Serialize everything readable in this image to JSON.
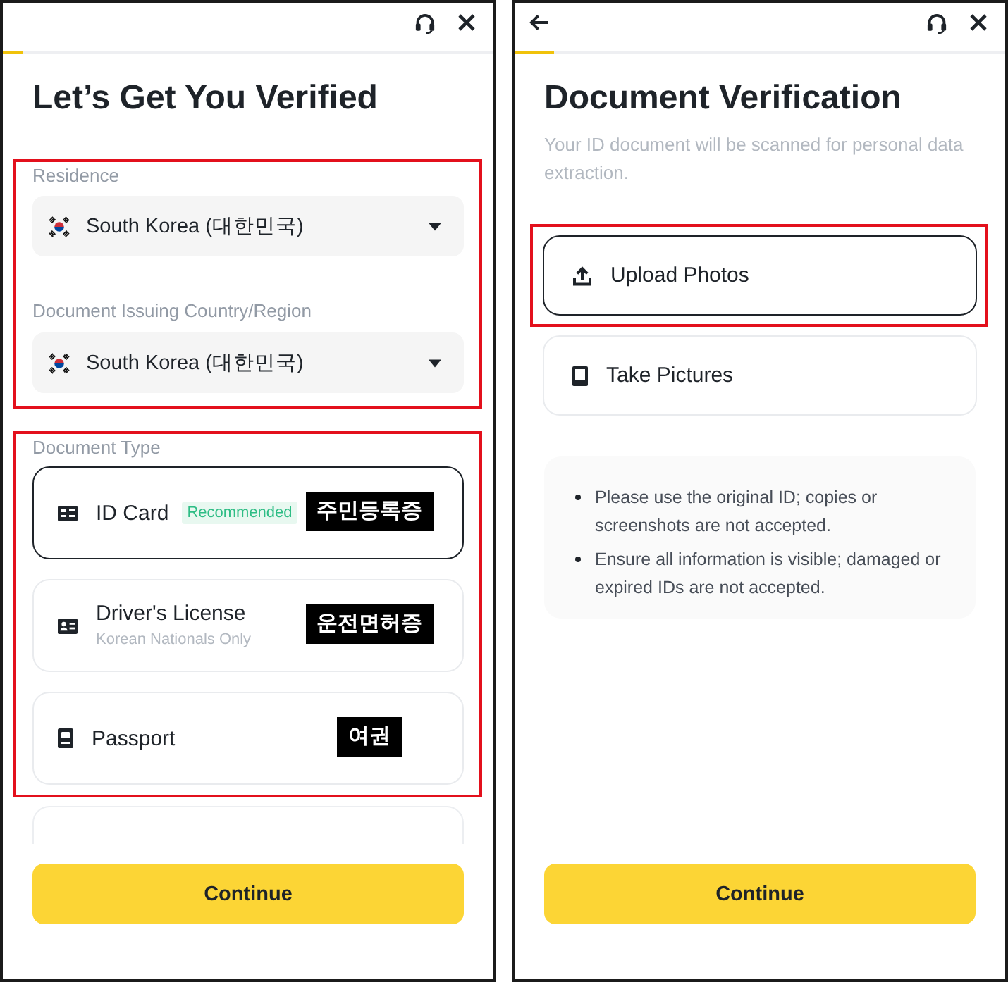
{
  "screens": [
    {
      "kind": "document_type",
      "back_button": false,
      "progress": {
        "level": 0.04
      },
      "title": "Let’s Get You Verified",
      "location_section": {
        "highlighted": true,
        "fields": [
          {
            "label": "Residence",
            "value": "South Korea (대한민국)"
          },
          {
            "label": "Document Issuing Country/Region",
            "value": "South Korea (대한민국)"
          }
        ]
      },
      "document_section": {
        "highlighted": true,
        "label": "Document Type",
        "options": [
          {
            "kind": "id_card",
            "title": "ID Card",
            "badge": "Recommended",
            "annotation": "주민등록증",
            "selected": true
          },
          {
            "kind": "drivers_license",
            "title": "Driver's License",
            "subtitle": "Korean Nationals Only",
            "annotation": "운전면허증",
            "selected": false
          },
          {
            "kind": "passport",
            "title": "Passport",
            "annotation": "여권",
            "selected": false
          }
        ],
        "more_below": true
      },
      "continue_button": "Continue"
    },
    {
      "kind": "capture_method",
      "back_button": true,
      "progress": {
        "level": 0.08
      },
      "title": "Document Verification",
      "subtitle": "Your ID document will be scanned for personal data extraction.",
      "methods": [
        {
          "kind": "upload",
          "label": "Upload Photos",
          "selected": true,
          "highlighted": true
        },
        {
          "kind": "camera",
          "label": "Take Pictures",
          "selected": false,
          "highlighted": false
        }
      ],
      "tips": [
        "Please use the original ID; copies or screenshots are not accepted.",
        "Ensure all information is visible; damaged or expired IDs are not accepted."
      ],
      "continue_button": "Continue"
    }
  ]
}
